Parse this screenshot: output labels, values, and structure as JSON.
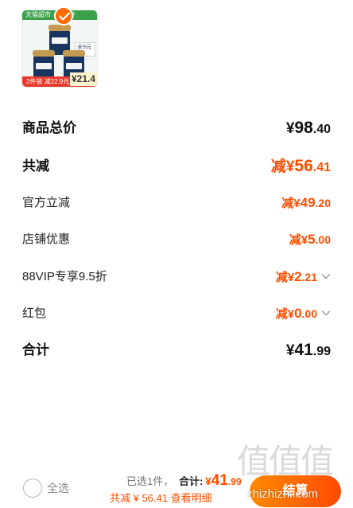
{
  "product": {
    "thumb_top_text": "天猫超市 · 官方补",
    "badge_text": "全9元",
    "promo_text": "2件装 减22.9元",
    "promo_price": "¥21.4",
    "selected": true
  },
  "summary": {
    "rows": [
      {
        "label": "商品总价",
        "value_prefix": "",
        "yen": "¥",
        "int": "98",
        "dec": ".40",
        "style": "total"
      },
      {
        "label": "共减",
        "value_prefix": "减",
        "yen": "¥",
        "int": "56",
        "dec": ".41",
        "style": "discount-total"
      },
      {
        "label": "官方立减",
        "value_prefix": "减",
        "yen": "¥",
        "int": "49",
        "dec": ".20",
        "style": "discount"
      },
      {
        "label": "店铺优惠",
        "value_prefix": "减",
        "yen": "¥",
        "int": "5",
        "dec": ".00",
        "style": "discount"
      },
      {
        "label": "88VIP专享9.5折",
        "value_prefix": "减",
        "yen": "¥",
        "int": "2",
        "dec": ".21",
        "style": "discount-expand"
      },
      {
        "label": "红包",
        "value_prefix": "减",
        "yen": "¥",
        "int": "0",
        "dec": ".00",
        "style": "discount-expand"
      },
      {
        "label": "合计",
        "value_prefix": "",
        "yen": "¥",
        "int": "41",
        "dec": ".99",
        "style": "total"
      }
    ]
  },
  "footer": {
    "select_all_label": "全选",
    "selected_count": "已选1件，",
    "total_label": "合计:",
    "total_yen": "¥",
    "total_int": "41",
    "total_dec": ".99",
    "saving_text": "共减 ¥ 56.41  查看明细",
    "checkout_label": "结算"
  },
  "watermark": {
    "glyphs": "值值值",
    "url": "zhizhizhi.com"
  },
  "colors": {
    "accent": "#ff4d00",
    "checkout_start": "#ff8a00",
    "checkout_end": "#ff4a00",
    "checkmark": "#ff6a00"
  }
}
